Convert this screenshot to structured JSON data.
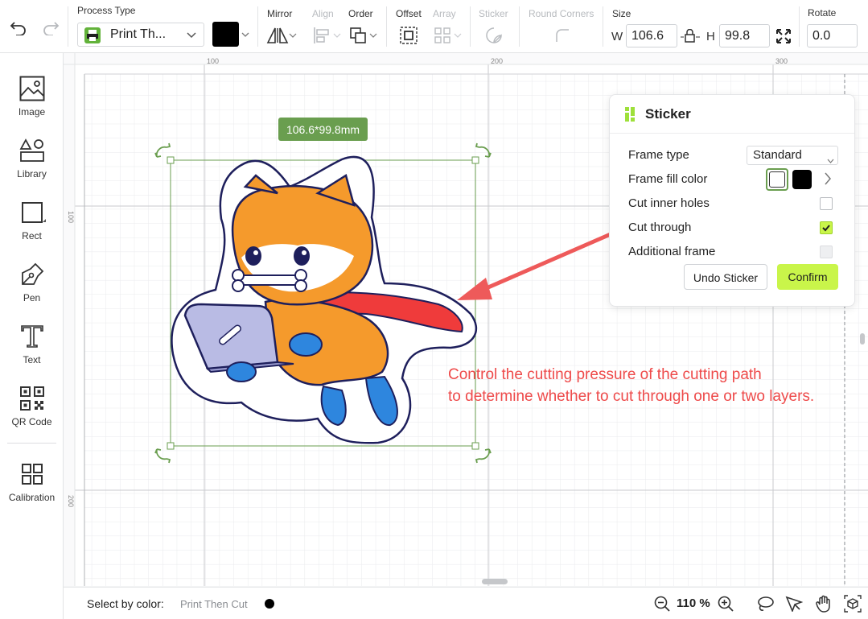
{
  "toolbar": {
    "process_type_label": "Process Type",
    "process_type_value": "Print Th...",
    "mirror_label": "Mirror",
    "align_label": "Align",
    "order_label": "Order",
    "offset_label": "Offset",
    "array_label": "Array",
    "sticker_label": "Sticker",
    "round_corners_label": "Round Corners",
    "size_label": "Size",
    "width_label": "W",
    "width_value": "106.6",
    "height_label": "H",
    "height_value": "99.8",
    "rotate_label": "Rotate",
    "rotate_value": "0.0",
    "color_value": "#000000"
  },
  "sidebar": {
    "items": [
      {
        "label": "Image",
        "icon": "image-icon"
      },
      {
        "label": "Library",
        "icon": "library-icon"
      },
      {
        "label": "Rect",
        "icon": "rect-icon"
      },
      {
        "label": "Pen",
        "icon": "pen-icon"
      },
      {
        "label": "Text",
        "icon": "text-icon"
      },
      {
        "label": "QR Code",
        "icon": "qr-code-icon"
      },
      {
        "label": "Calibration",
        "icon": "calibration-icon"
      }
    ]
  },
  "canvas": {
    "ruler_top": [
      "100",
      "200",
      "300"
    ],
    "ruler_left": [
      "100",
      "200"
    ],
    "dimension_label": "106.6*99.8mm",
    "annotation_line1": "Control the cutting pressure of the cutting path",
    "annotation_line2": "to determine whether to cut through one or two layers.",
    "accent_color": "#ee4a4a",
    "selection_color": "#6a9e4f"
  },
  "sticker_panel": {
    "title": "Sticker",
    "frame_type_label": "Frame type",
    "frame_type_value": "Standard",
    "frame_fill_color_label": "Frame fill color",
    "cut_inner_holes_label": "Cut inner holes",
    "cut_inner_holes_checked": false,
    "cut_through_label": "Cut through",
    "cut_through_checked": true,
    "additional_frame_label": "Additional frame",
    "additional_frame_enabled": false,
    "undo_button": "Undo Sticker",
    "confirm_button": "Confirm",
    "confirm_color": "#c9f54a"
  },
  "statusbar": {
    "select_by_color_label": "Select by color:",
    "select_by_color_value": "Print Then Cut",
    "zoom_value": "110 %"
  }
}
